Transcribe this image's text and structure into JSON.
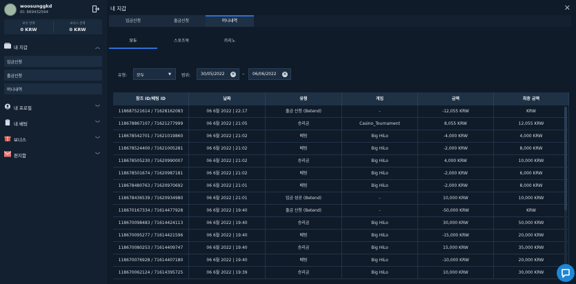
{
  "user": {
    "name": "woosunggkd",
    "id": "ID: 669432594"
  },
  "balances": [
    {
      "label": "보유 잔액",
      "value": "0 KRW"
    },
    {
      "label": "보너스 잔액",
      "value": "0 KRW"
    }
  ],
  "sidebar": {
    "wallet": "내 지갑",
    "wallet_items": [
      "입금신청",
      "출금신청",
      "머니내역"
    ],
    "menus": [
      "내 프로필",
      "내 베팅",
      "보너스",
      "편지함"
    ]
  },
  "page_title": "내 지갑",
  "tabs": [
    "입금신청",
    "출금신청",
    "머니내역"
  ],
  "subtabs": [
    "모두",
    "스포츠북",
    "카지노"
  ],
  "filters": {
    "type_label": "유형:",
    "type_value": "모두",
    "range_label": "범위:",
    "from": "30/05/2022",
    "to": "06/06/2022",
    "dash": "–"
  },
  "table": {
    "headers": [
      "참조 ID/베팅 ID",
      "날짜",
      "유형",
      "게임",
      "금액",
      "최종 금액"
    ],
    "rows": [
      [
        "118687521614 / 71628162083",
        "06 6월 2022 | 22:17",
        "출금 신청 (Betend)",
        "-",
        "-12,055 KRW",
        "KRW"
      ],
      [
        "118678867107 / 71621277999",
        "06 6월 2022 | 21:05",
        "승리금",
        "Casino_Tournament",
        "8,055 KRW",
        "12,055 KRW"
      ],
      [
        "118678542701 / 71621019860",
        "06 6월 2022 | 21:02",
        "베팅",
        "Big HiLo",
        "-4,000 KRW",
        "4,000 KRW"
      ],
      [
        "118678524400 / 71621005281",
        "06 6월 2022 | 21:02",
        "베팅",
        "Big HiLo",
        "-2,000 KRW",
        "8,000 KRW"
      ],
      [
        "118678505230 / 71620990007",
        "06 6월 2022 | 21:02",
        "승리금",
        "Big HiLo",
        "4,000 KRW",
        "10,000 KRW"
      ],
      [
        "118678501674 / 71620987181",
        "06 6월 2022 | 21:02",
        "베팅",
        "Big HiLo",
        "-2,000 KRW",
        "6,000 KRW"
      ],
      [
        "118678480763 / 71620970692",
        "06 6월 2022 | 21:01",
        "베팅",
        "Big HiLo",
        "-2,000 KRW",
        "8,000 KRW"
      ],
      [
        "118678436539 / 71620934980",
        "06 6월 2022 | 21:01",
        "입금 성공 (Betend)",
        "-",
        "10,000 KRW",
        "10,000 KRW"
      ],
      [
        "118670167334 / 71614477928",
        "06 6월 2022 | 19:40",
        "출금 신청 (Betend)",
        "-",
        "-50,000 KRW",
        "KRW"
      ],
      [
        "118670098483 / 71614424113",
        "06 6월 2022 | 19:40",
        "승리금",
        "Big HiLo",
        "30,000 KRW",
        "50,000 KRW"
      ],
      [
        "118670095277 / 71614421596",
        "06 6월 2022 | 19:40",
        "베팅",
        "Big HiLo",
        "-15,000 KRW",
        "20,000 KRW"
      ],
      [
        "118670080253 / 71614409747",
        "06 6월 2022 | 19:40",
        "승리금",
        "Big HiLo",
        "15,000 KRW",
        "35,000 KRW"
      ],
      [
        "118670076928 / 71614407180",
        "06 6월 2022 | 19:40",
        "베팅",
        "Big HiLo",
        "-10,000 KRW",
        "20,000 KRW"
      ],
      [
        "118670062124 / 71614395725",
        "06 6월 2022 | 19:39",
        "승리금",
        "Big HiLo",
        "10,000 KRW",
        "30,000 KRW"
      ]
    ]
  },
  "colors": {
    "accent": "#2f6fd6",
    "chat": "#1f86d6"
  }
}
